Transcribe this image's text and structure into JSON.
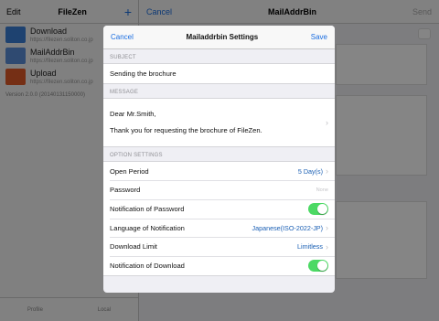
{
  "background": {
    "left_nav": {
      "edit": "Edit",
      "title": "FileZen",
      "add": "+"
    },
    "items": [
      {
        "title": "Download",
        "url": "https://filezen.soliton.co.jp",
        "icon": "filezen-icon",
        "color": "#3b7fd6"
      },
      {
        "title": "MailAddrBin",
        "url": "https://filezen.soliton.co.jp",
        "icon": "mail-icon",
        "color": "#3b7fd6"
      },
      {
        "title": "Upload",
        "url": "https://filezen.soliton.co.jp",
        "icon": "upload-icon",
        "color": "#e05a2a"
      }
    ],
    "version": "Version 2.0.0 (20140131150000)",
    "bottom_tabs": [
      "Profile",
      "Local"
    ],
    "right_nav": {
      "cancel": "Cancel",
      "title": "MailAddrBin",
      "send": "Send"
    }
  },
  "modal": {
    "cancel": "Cancel",
    "title": "Mailaddrbin Settings",
    "save": "Save",
    "subject_header": "SUBJECT",
    "subject": "Sending the brochure",
    "message_header": "MESSAGE",
    "message_line1": "Dear Mr.Smith,",
    "message_line2": "Thank you for requesting the brochure of FileZen.",
    "options_header": "OPTION SETTINGS",
    "options": {
      "open_period_label": "Open Period",
      "open_period_value": "5 Day(s)",
      "password_label": "Password",
      "password_placeholder": "None",
      "notify_password_label": "Notification of Password",
      "notify_password_on": true,
      "language_label": "Language of Notification",
      "language_value": "Japanese(ISO-2022-JP)",
      "download_limit_label": "Download Limit",
      "download_limit_value": "Limitless",
      "notify_download_label": "Notification of Download",
      "notify_download_on": true
    }
  },
  "colors": {
    "accent": "#1a6de0",
    "toggle_on": "#4cd964"
  }
}
